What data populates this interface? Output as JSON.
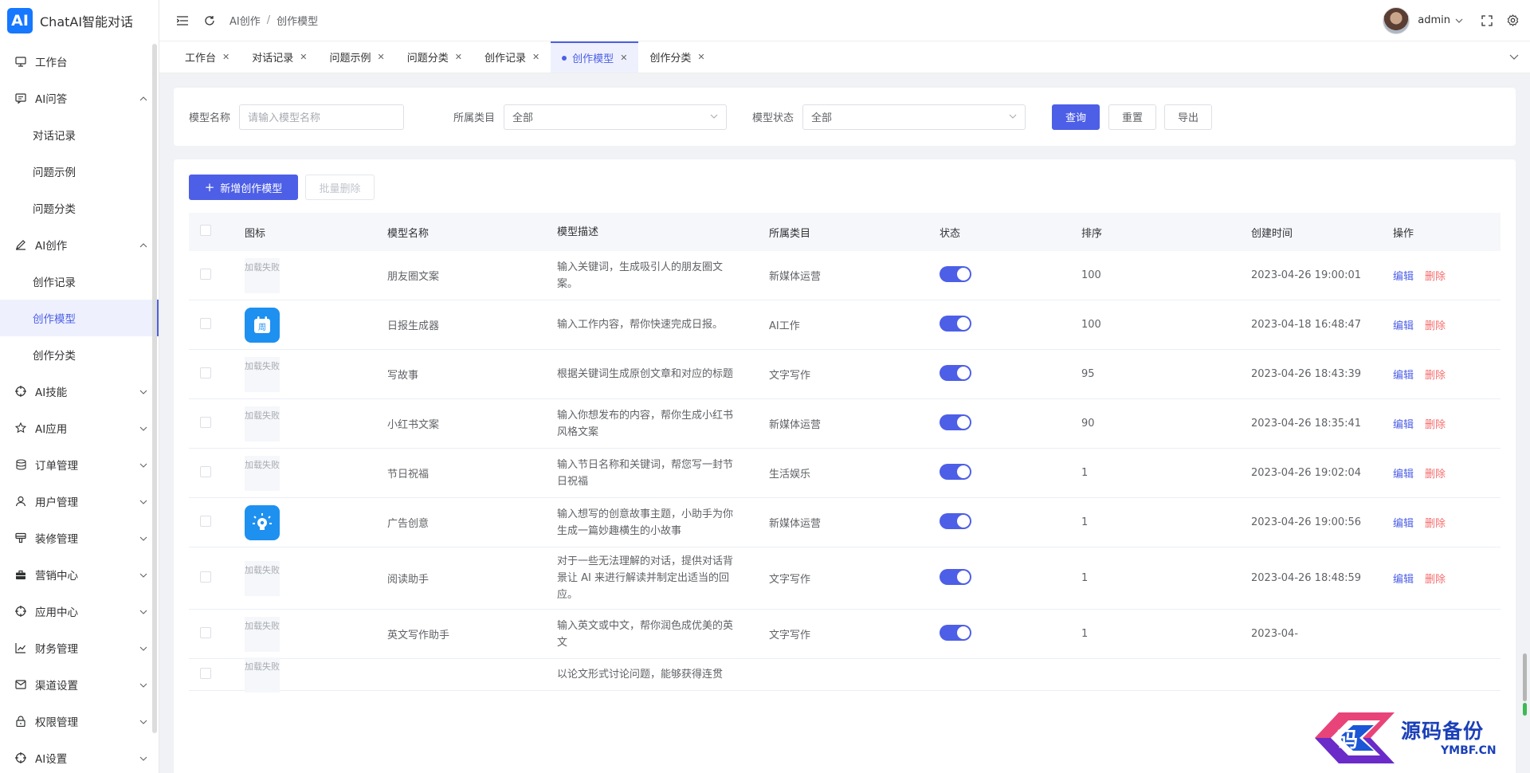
{
  "brand": {
    "logo_text": "AI",
    "name": "ChatAI智能对话"
  },
  "sidebar": {
    "items": [
      {
        "label": "工作台",
        "icon": "monitor-icon",
        "expandable": false
      },
      {
        "label": "AI问答",
        "icon": "chat-icon",
        "expandable": true,
        "expanded": true,
        "children": [
          "对话记录",
          "问题示例",
          "问题分类"
        ]
      },
      {
        "label": "AI创作",
        "icon": "pen-icon",
        "expandable": true,
        "expanded": true,
        "children": [
          "创作记录",
          "创作模型",
          "创作分类"
        ],
        "active_child": "创作模型"
      },
      {
        "label": "AI技能",
        "icon": "target-icon",
        "expandable": true
      },
      {
        "label": "AI应用",
        "icon": "star-icon",
        "expandable": true
      },
      {
        "label": "订单管理",
        "icon": "database-icon",
        "expandable": true
      },
      {
        "label": "用户管理",
        "icon": "user-icon",
        "expandable": true
      },
      {
        "label": "装修管理",
        "icon": "brush-icon",
        "expandable": true
      },
      {
        "label": "营销中心",
        "icon": "briefcase-icon",
        "expandable": true
      },
      {
        "label": "应用中心",
        "icon": "target-icon",
        "expandable": true
      },
      {
        "label": "财务管理",
        "icon": "chart-icon",
        "expandable": true
      },
      {
        "label": "渠道设置",
        "icon": "mail-icon",
        "expandable": true
      },
      {
        "label": "权限管理",
        "icon": "lock-icon",
        "expandable": true
      },
      {
        "label": "AI设置",
        "icon": "target-icon",
        "expandable": true
      }
    ]
  },
  "header": {
    "breadcrumb": [
      "AI创作",
      "创作模型"
    ],
    "username": "admin"
  },
  "tabs": [
    {
      "label": "工作台",
      "active": false
    },
    {
      "label": "对话记录",
      "active": false
    },
    {
      "label": "问题示例",
      "active": false
    },
    {
      "label": "问题分类",
      "active": false
    },
    {
      "label": "创作记录",
      "active": false
    },
    {
      "label": "创作模型",
      "active": true
    },
    {
      "label": "创作分类",
      "active": false
    }
  ],
  "filter": {
    "name_label": "模型名称",
    "name_placeholder": "请输入模型名称",
    "category_label": "所属类目",
    "category_value": "全部",
    "status_label": "模型状态",
    "status_value": "全部",
    "query_btn": "查询",
    "reset_btn": "重置",
    "export_btn": "导出"
  },
  "toolbar": {
    "add_btn": "新增创作模型",
    "batch_delete_btn": "批量删除"
  },
  "table": {
    "columns": [
      "图标",
      "模型名称",
      "模型描述",
      "所属类目",
      "状态",
      "排序",
      "创建时间",
      "操作"
    ],
    "fail_text": "加载失败",
    "edit_label": "编辑",
    "delete_label": "删除",
    "rows": [
      {
        "icon": "fail",
        "name": "朋友圈文案",
        "desc": "输入关键词，生成吸引人的朋友圈文案。",
        "category": "新媒体运营",
        "status": true,
        "sort": "100",
        "time": "2023-04-26 19:00:01"
      },
      {
        "icon": "calendar-app-icon",
        "name": "日报生成器",
        "desc": "输入工作内容，帮你快速完成日报。",
        "category": "AI工作",
        "status": true,
        "sort": "100",
        "time": "2023-04-18 16:48:47"
      },
      {
        "icon": "fail",
        "name": "写故事",
        "desc": "根据关键词生成原创文章和对应的标题",
        "category": "文字写作",
        "status": true,
        "sort": "95",
        "time": "2023-04-26 18:43:39"
      },
      {
        "icon": "fail",
        "name": "小红书文案",
        "desc": "输入你想发布的内容，帮你生成小红书风格文案",
        "category": "新媒体运营",
        "status": true,
        "sort": "90",
        "time": "2023-04-26 18:35:41"
      },
      {
        "icon": "fail",
        "name": "节日祝福",
        "desc": "输入节日名称和关键词，帮您写一封节日祝福",
        "category": "生活娱乐",
        "status": true,
        "sort": "1",
        "time": "2023-04-26 19:02:04"
      },
      {
        "icon": "lightbulb-app-icon",
        "name": "广告创意",
        "desc": "输入想写的创意故事主题，小助手为你生成一篇妙趣横生的小故事",
        "category": "新媒体运营",
        "status": true,
        "sort": "1",
        "time": "2023-04-26 19:00:56"
      },
      {
        "icon": "fail",
        "name": "阅读助手",
        "desc": "对于一些无法理解的对话，提供对话背景让 AI 来进行解读并制定出适当的回应。",
        "category": "文字写作",
        "status": true,
        "sort": "1",
        "time": "2023-04-26 18:48:59"
      },
      {
        "icon": "fail",
        "name": "英文写作助手",
        "desc": "输入英文或中文，帮你润色成优美的英文",
        "category": "文字写作",
        "status": true,
        "sort": "1",
        "time": "2023-04-"
      },
      {
        "icon": "fail",
        "name": "",
        "desc": "以论文形式讨论问题，能够获得连贯",
        "category": "",
        "status": null,
        "sort": "",
        "time": ""
      }
    ]
  },
  "watermark": {
    "main": "源码备份",
    "sub": "YMBF.CN",
    "badge_char": "码"
  },
  "colors": {
    "primary": "#4d5fe6",
    "danger": "#f56c6c",
    "app_icon_blue": "#1e90f0"
  }
}
